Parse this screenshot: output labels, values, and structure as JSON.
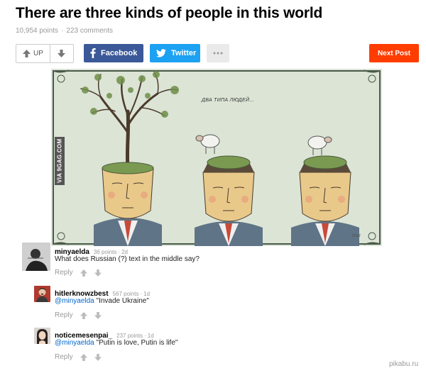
{
  "post": {
    "title": "There are three kinds of people in this world",
    "points": "10,954 points",
    "separator": "·",
    "comments": "223 comments"
  },
  "actions": {
    "up_label": "UP",
    "facebook_label": "Facebook",
    "twitter_label": "Twitter",
    "next_label": "Next Post"
  },
  "image": {
    "watermark": "VIA 9GAG.COM",
    "caption": "ДВА ТИПА ЛЮДЕЙ...",
    "signature": "Matt",
    "background_color": "#dce4d6"
  },
  "comments": [
    {
      "username": "minyaelda",
      "points": "36 points",
      "dot": "·",
      "time": "2d",
      "mention": "",
      "text": "What does Russian (?) text in the middle say?",
      "reply_label": "Reply"
    },
    {
      "username": "hitlerknowzbest",
      "points": "567 points",
      "dot": "·",
      "time": "1d",
      "mention": "@minyaelda",
      "text": " \"Invade Ukraine\"",
      "reply_label": "Reply"
    },
    {
      "username": "noticemesenpai_",
      "points": "237 points",
      "dot": "·",
      "time": "1d",
      "mention": "@minyaelda",
      "text": " \"Putin is love, Putin is life\"",
      "reply_label": "Reply"
    }
  ],
  "footer": {
    "site_mark": "pikabu.ru"
  },
  "colors": {
    "facebook": "#3b5998",
    "twitter": "#1da1f2",
    "next_post": "#ff3d00",
    "mention_link": "#0066cc"
  },
  "icons": [
    "arrow-up-icon",
    "arrow-down-icon",
    "facebook-icon",
    "twitter-icon",
    "more-dots-icon"
  ]
}
